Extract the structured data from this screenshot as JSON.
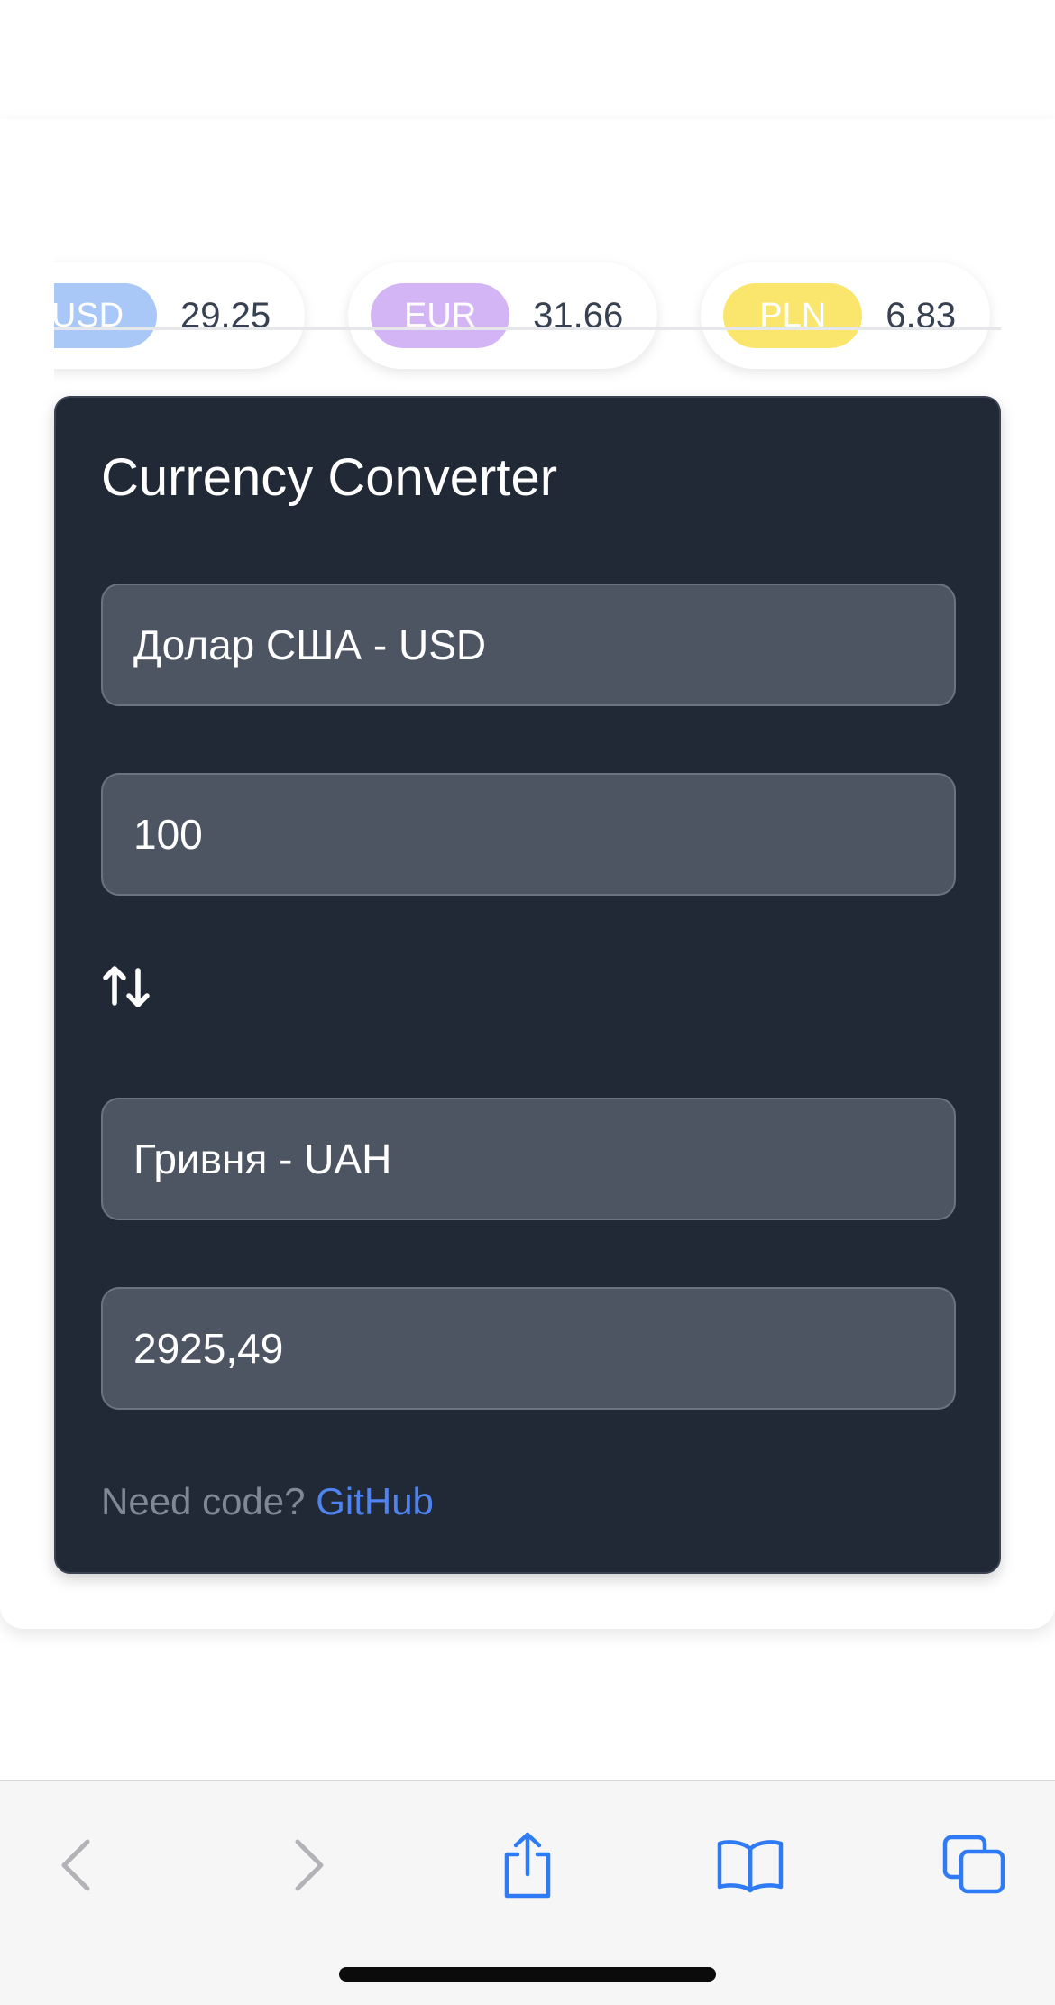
{
  "rates": [
    {
      "code": "USD",
      "value": "29.25",
      "color": "#a9c8f7"
    },
    {
      "code": "EUR",
      "value": "31.66",
      "color": "#d3b5f6"
    },
    {
      "code": "PLN",
      "value": "6.83",
      "color": "#fae56d"
    }
  ],
  "converter": {
    "title": "Currency Converter",
    "from_currency": "Долар США - USD",
    "amount": "100",
    "to_currency": "Гривня - UAH",
    "result": "2925,49",
    "footer_text": "Need code?",
    "footer_link": "GitHub"
  },
  "toolbar": {
    "icons": [
      "back-icon",
      "forward-icon",
      "share-icon",
      "bookmarks-icon",
      "tabs-icon"
    ],
    "accent": "#2f7bf5"
  }
}
